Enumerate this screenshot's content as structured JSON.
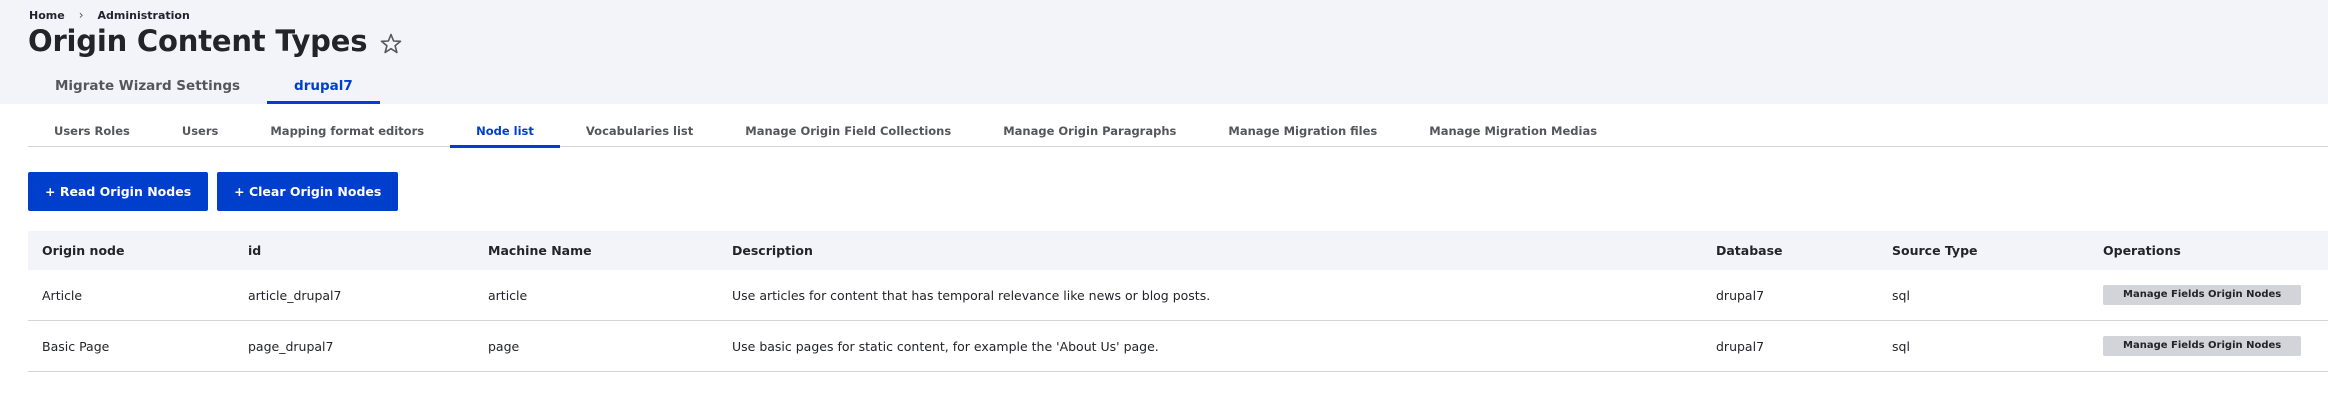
{
  "breadcrumb": {
    "items": [
      "Home",
      "Administration"
    ],
    "separator": "›"
  },
  "page": {
    "title": "Origin Content Types",
    "star_icon": "star-outline-icon"
  },
  "primary_tabs": [
    {
      "label": "Migrate Wizard Settings",
      "active": false
    },
    {
      "label": "drupal7",
      "active": true
    }
  ],
  "secondary_tabs": [
    {
      "label": "Users Roles",
      "active": false
    },
    {
      "label": "Users",
      "active": false
    },
    {
      "label": "Mapping format editors",
      "active": false
    },
    {
      "label": "Node list",
      "active": true
    },
    {
      "label": "Vocabularies list",
      "active": false
    },
    {
      "label": "Manage Origin Field Collections",
      "active": false
    },
    {
      "label": "Manage Origin Paragraphs",
      "active": false
    },
    {
      "label": "Manage Migration files",
      "active": false
    },
    {
      "label": "Manage Migration Medias",
      "active": false
    }
  ],
  "actions": {
    "read_label": "+ Read Origin Nodes",
    "clear_label": "+ Clear Origin Nodes"
  },
  "table": {
    "headers": [
      "Origin node",
      "id",
      "Machine Name",
      "Description",
      "Database",
      "Source Type",
      "Operations"
    ],
    "rows": [
      {
        "origin_node": "Article",
        "id": "article_drupal7",
        "machine_name": "article",
        "description": "Use articles for content that has temporal relevance like news or blog posts.",
        "database": "drupal7",
        "source_type": "sql",
        "operation": "Manage Fields Origin Nodes"
      },
      {
        "origin_node": "Basic Page",
        "id": "page_drupal7",
        "machine_name": "page",
        "description": "Use basic pages for static content, for example the 'About Us' page.",
        "database": "drupal7",
        "source_type": "sql",
        "operation": "Manage Fields Origin Nodes"
      }
    ]
  },
  "colors": {
    "accent": "#003ecc",
    "header_bg": "#f3f4f9",
    "border": "#d3d4d9",
    "text": "#232429"
  }
}
